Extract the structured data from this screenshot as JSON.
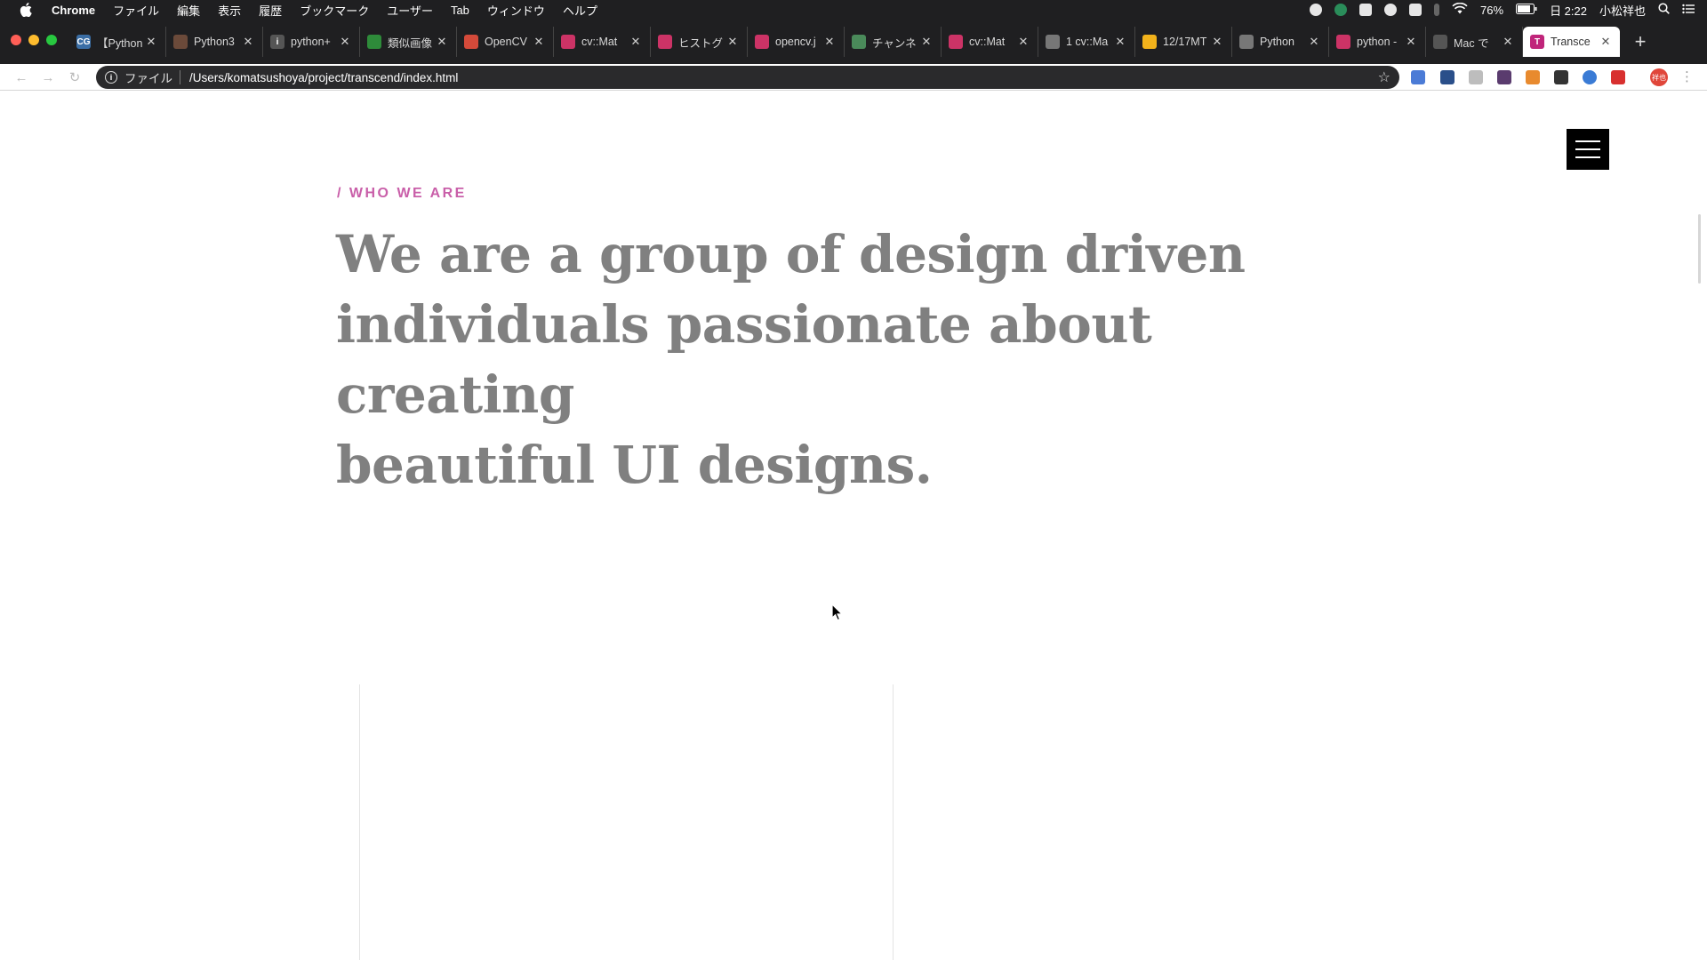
{
  "menubar": {
    "app": "Chrome",
    "items": [
      "ファイル",
      "編集",
      "表示",
      "履歴",
      "ブックマーク",
      "ユーザー",
      "Tab",
      "ウィンドウ",
      "ヘルプ"
    ],
    "battery": "76%",
    "clock": "日 2:22",
    "user": "小松祥也"
  },
  "tabs": [
    {
      "label": "【Python",
      "fav_color": "#3b6ea5",
      "fav_text": "CG"
    },
    {
      "label": "Python3",
      "fav_color": "#6b4a3a",
      "fav_text": ""
    },
    {
      "label": "python+",
      "fav_color": "#555555",
      "fav_text": "i"
    },
    {
      "label": "類似画像",
      "fav_color": "#2e8b3a",
      "fav_text": ""
    },
    {
      "label": "OpenCV",
      "fav_color": "#d44a3a",
      "fav_text": ""
    },
    {
      "label": "cv::Mat",
      "fav_color": "#cc3366",
      "fav_text": ""
    },
    {
      "label": "ヒストグ",
      "fav_color": "#cc3366",
      "fav_text": ""
    },
    {
      "label": "opencv.j",
      "fav_color": "#cc3366",
      "fav_text": ""
    },
    {
      "label": "チャンネ",
      "fav_color": "#4a8a5a",
      "fav_text": ""
    },
    {
      "label": "cv::Mat",
      "fav_color": "#cc3366",
      "fav_text": ""
    },
    {
      "label": "1 cv::Ma",
      "fav_color": "#777777",
      "fav_text": ""
    },
    {
      "label": "12/17MT",
      "fav_color": "#f2b21b",
      "fav_text": ""
    },
    {
      "label": "Python",
      "fav_color": "#777777",
      "fav_text": ""
    },
    {
      "label": "python -",
      "fav_color": "#cc3366",
      "fav_text": ""
    },
    {
      "label": "Mac で",
      "fav_color": "#555555",
      "fav_text": ""
    },
    {
      "label": "Transce",
      "fav_color": "#c0257a",
      "fav_text": "T",
      "active": true
    }
  ],
  "address_bar": {
    "scheme_label": "ファイル",
    "url": "/Users/komatsushoya/project/transcend/index.html"
  },
  "profile_label": "祥也",
  "page": {
    "eyebrow": "/ WHO WE ARE",
    "headline_lines": [
      "We are a group of design driven",
      "individuals passionate about creating",
      "beautiful UI designs."
    ]
  },
  "colors": {
    "accent": "#c95fa9",
    "headline": "#808080",
    "chrome_dark": "#1f1f21"
  }
}
